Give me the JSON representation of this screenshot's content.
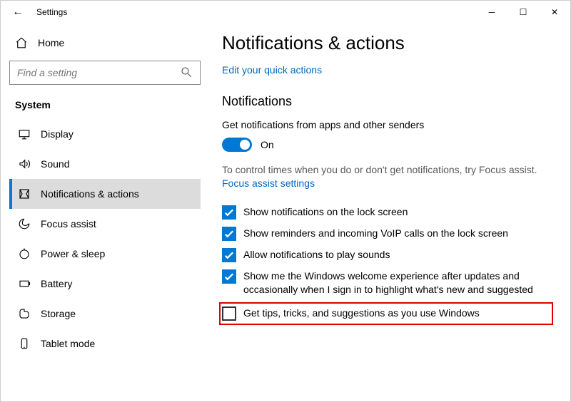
{
  "window": {
    "title": "Settings"
  },
  "sidebar": {
    "home": "Home",
    "searchPlaceholder": "Find a setting",
    "category": "System",
    "items": [
      {
        "label": "Display"
      },
      {
        "label": "Sound"
      },
      {
        "label": "Notifications & actions",
        "selected": true
      },
      {
        "label": "Focus assist"
      },
      {
        "label": "Power & sleep"
      },
      {
        "label": "Battery"
      },
      {
        "label": "Storage"
      },
      {
        "label": "Tablet mode"
      }
    ]
  },
  "main": {
    "title": "Notifications & actions",
    "quickActionsLink": "Edit your quick actions",
    "section": "Notifications",
    "getNotifications": "Get notifications from apps and other senders",
    "toggleLabel": "On",
    "focusText": "To control times when you do or don't get notifications, try Focus assist.",
    "focusLink": "Focus assist settings",
    "opts": [
      {
        "label": "Show notifications on the lock screen",
        "checked": true
      },
      {
        "label": "Show reminders and incoming VoIP calls on the lock screen",
        "checked": true
      },
      {
        "label": "Allow notifications to play sounds",
        "checked": true
      },
      {
        "label": "Show me the Windows welcome experience after updates and occasionally when I sign in to highlight what's new and suggested",
        "checked": true
      },
      {
        "label": "Get tips, tricks, and suggestions as you use Windows",
        "checked": false,
        "highlight": true
      }
    ]
  }
}
